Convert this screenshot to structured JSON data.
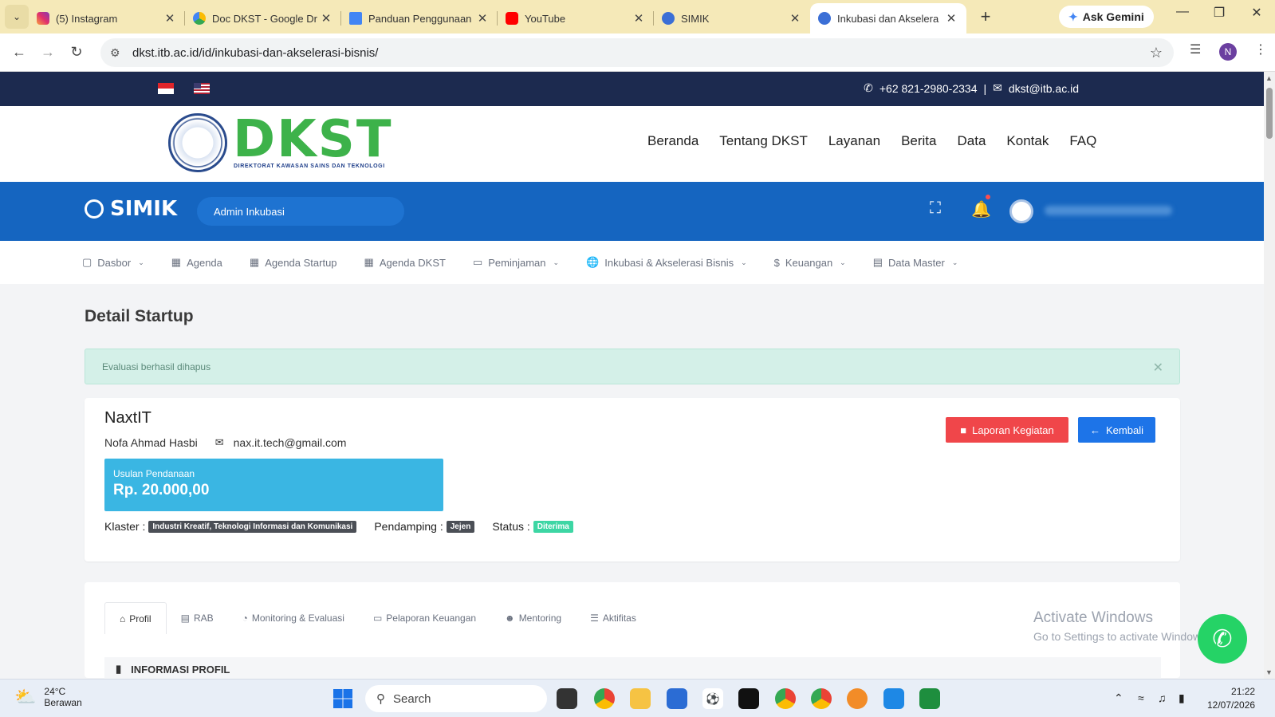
{
  "browser": {
    "tabs": [
      {
        "title": "(5) Instagram",
        "icon": "instagram-icon"
      },
      {
        "title": "Doc DKST - Google Dr",
        "icon": "google-drive-icon"
      },
      {
        "title": "Panduan Penggunaan",
        "icon": "google-docs-icon"
      },
      {
        "title": "YouTube",
        "icon": "youtube-icon"
      },
      {
        "title": "SIMIK",
        "icon": "globe-icon"
      },
      {
        "title": "Inkubasi dan Akselera",
        "icon": "globe-icon",
        "active": true
      }
    ],
    "ask_gemini": "Ask Gemini",
    "url": "dkst.itb.ac.id/id/inkubasi-dan-akselerasi-bisnis/",
    "profile_initial": "N"
  },
  "site": {
    "phone": "+62 821-2980-2334",
    "email": "dkst@itb.ac.id",
    "logo_text": "DKST",
    "logo_subtitle": "DIREKTORAT KAWASAN SAINS DAN TEKNOLOGI",
    "nav": [
      "Beranda",
      "Tentang DKST",
      "Layanan",
      "Berita",
      "Data",
      "Kontak",
      "FAQ"
    ]
  },
  "simik": {
    "brand": "SIMIK",
    "role": "Admin Inkubasi",
    "menu": [
      {
        "label": "Dasbor",
        "icon": "monitor-icon",
        "dropdown": true
      },
      {
        "label": "Agenda",
        "icon": "calendar-icon",
        "dropdown": false
      },
      {
        "label": "Agenda Startup",
        "icon": "calendar-icon",
        "dropdown": false
      },
      {
        "label": "Agenda DKST",
        "icon": "calendar-icon",
        "dropdown": false
      },
      {
        "label": "Peminjaman",
        "icon": "credit-card-icon",
        "dropdown": true
      },
      {
        "label": "Inkubasi & Akselerasi Bisnis",
        "icon": "globe-icon",
        "dropdown": true
      },
      {
        "label": "Keuangan",
        "icon": "dollar-icon",
        "dropdown": true
      },
      {
        "label": "Data Master",
        "icon": "inbox-icon",
        "dropdown": true
      }
    ]
  },
  "page": {
    "title": "Detail Startup",
    "alert": "Evaluasi berhasil dihapus",
    "startup": {
      "name": "NaxtIT",
      "owner": "Nofa Ahmad Hasbi",
      "email": "nax.it.tech@gmail.com",
      "funding_label": "Usulan Pendanaan",
      "funding_value": "Rp. 20.000,00",
      "klaster_label": "Klaster :",
      "klaster_value": "Industri Kreatif, Teknologi Informasi dan Komunikasi",
      "pendamping_label": "Pendamping :",
      "pendamping_value": "Jejen",
      "status_label": "Status :",
      "status_value": "Diterima"
    },
    "buttons": {
      "report": "Laporan Kegiatan",
      "back": "Kembali"
    },
    "tabs": [
      {
        "label": "Profil",
        "icon": "home-icon",
        "active": true
      },
      {
        "label": "RAB",
        "icon": "file-icon"
      },
      {
        "label": "Monitoring & Evaluasi",
        "icon": "gauge-icon"
      },
      {
        "label": "Pelaporan Keuangan",
        "icon": "money-icon"
      },
      {
        "label": "Mentoring",
        "icon": "users-icon"
      },
      {
        "label": "Aktifitas",
        "icon": "list-icon"
      }
    ],
    "section_title": "INFORMASI PROFIL"
  },
  "watermark": {
    "line1": "Activate Windows",
    "line2": "Go to Settings to activate Windows."
  },
  "taskbar": {
    "temperature": "24°C",
    "weather": "Berawan",
    "search_placeholder": "Search",
    "time": "21:22",
    "date": "12/07/2026"
  }
}
